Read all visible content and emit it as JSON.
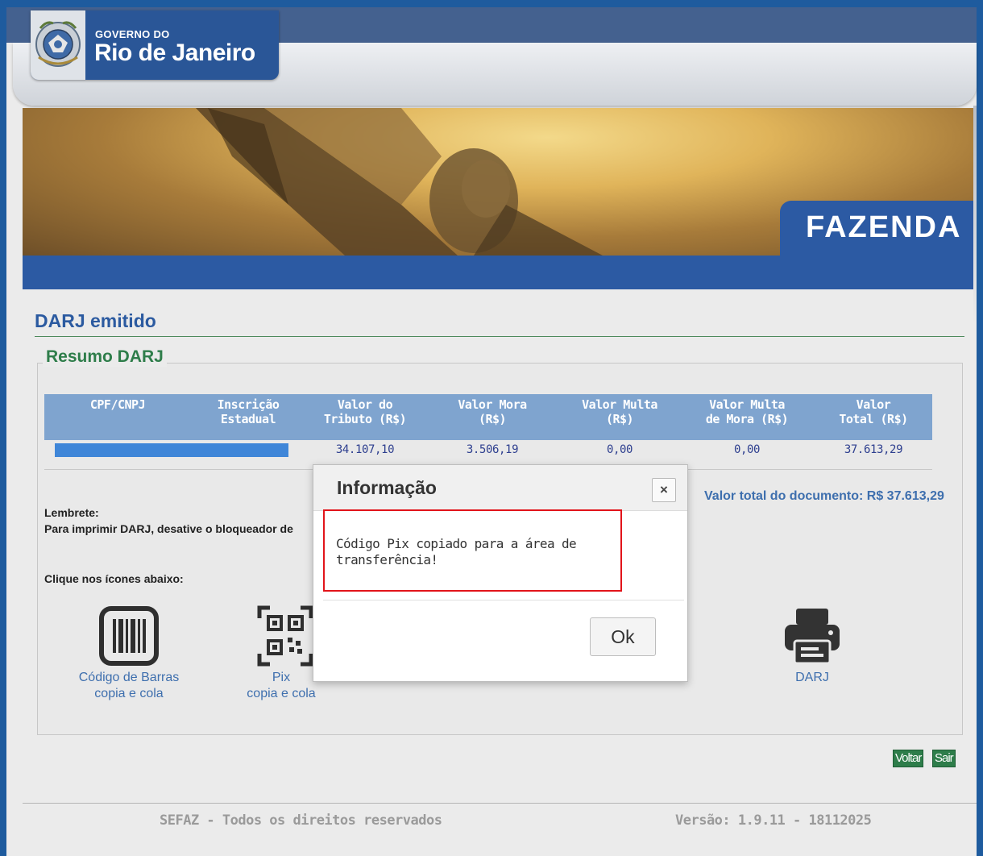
{
  "header": {
    "logo_small": "GOVERNO DO",
    "logo_big": "Rio de Janeiro",
    "banner_tab": "FAZENDA"
  },
  "main": {
    "page_title": "DARJ emitido",
    "section_legend": "Resumo DARJ",
    "table": {
      "columns": [
        [
          "CPF/CNPJ"
        ],
        [
          "Inscrição",
          "Estadual"
        ],
        [
          "Valor do",
          "Tributo (R$)"
        ],
        [
          "Valor Mora",
          "(R$)"
        ],
        [
          "Valor Multa",
          "(R$)"
        ],
        [
          "Valor Multa",
          "de Mora (R$)"
        ],
        [
          "Valor",
          "Total (R$)"
        ]
      ],
      "row": [
        "",
        "",
        "34.107,10",
        "3.506,19",
        "0,00",
        "0,00",
        "37.613,29"
      ]
    },
    "valor_total": "Valor total do documento: R$ 37.613,29",
    "lembrete_title": "Lembrete:",
    "lembrete_text": "Para imprimir DARJ, desative o bloqueador de",
    "clique_text": "Clique nos ícones abaixo:",
    "icons": {
      "barcode": {
        "icon": "barcode-icon",
        "line1": "Código de Barras",
        "line2": "copia e cola"
      },
      "pix": {
        "icon": "qr-code-icon",
        "line1": "Pix",
        "line2": "copia e cola"
      },
      "darj": {
        "icon": "printer-icon",
        "line1": "DARJ"
      }
    },
    "voltar": "Voltar",
    "sair": "Sair"
  },
  "footer": {
    "left": "SEFAZ - Todos os direitos reservados",
    "right": "Versão: 1.9.11 - 18112025"
  },
  "dialog": {
    "title": "Informação",
    "close_icon": "×",
    "message": "Código Pix copiado para a área de transferência!",
    "ok": "Ok",
    "highlight_color": "#e2141a"
  },
  "colors": {
    "brand_blue": "#2c5aa3",
    "table_header": "#7fa4cf",
    "green": "#2e7d4a",
    "link_blue": "#3e6fae"
  }
}
